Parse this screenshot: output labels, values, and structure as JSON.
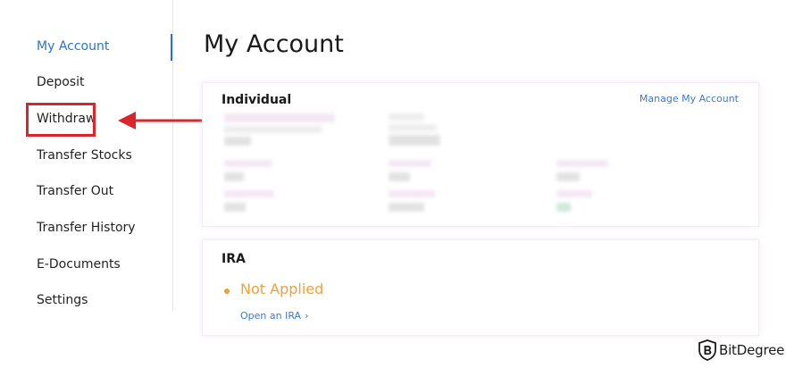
{
  "sidebar": {
    "items": [
      {
        "label": "My Account",
        "active": true
      },
      {
        "label": "Deposit",
        "active": false
      },
      {
        "label": "Withdraw",
        "active": false,
        "highlighted": true
      },
      {
        "label": "Transfer Stocks",
        "active": false
      },
      {
        "label": "Transfer Out",
        "active": false
      },
      {
        "label": "Transfer History",
        "active": false
      },
      {
        "label": "E-Documents",
        "active": false
      },
      {
        "label": "Settings",
        "active": false
      }
    ]
  },
  "main": {
    "title": "My Account",
    "individual": {
      "title": "Individual",
      "manage_link": "Manage My Account"
    },
    "ira": {
      "title": "IRA",
      "status": "Not Applied",
      "open_link": "Open an IRA",
      "open_link_icon": "chevron-right-icon"
    }
  },
  "watermark": {
    "text": "BitDegree",
    "icon": "bitdegree-shield-logo"
  },
  "colors": {
    "accent": "#2c74c7",
    "link": "#3d7ac7",
    "highlight": "#d9262c",
    "status": "#f0a03a",
    "text": "#222222"
  }
}
